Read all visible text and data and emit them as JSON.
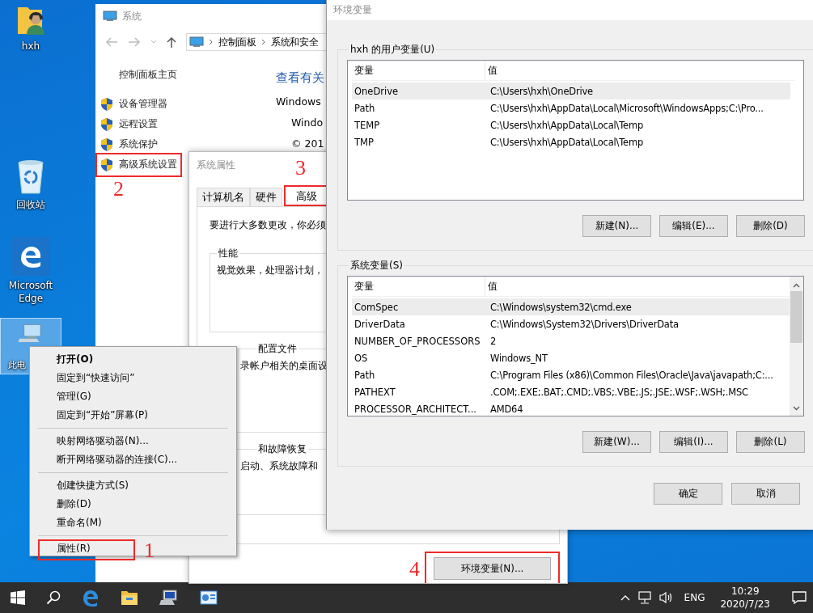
{
  "desktop": {
    "icons": [
      {
        "kind": "user",
        "label": "hxh",
        "selected": false
      },
      {
        "kind": "recycle",
        "label": "回收站",
        "selected": false
      },
      {
        "kind": "edge",
        "label": "Microsoft Edge",
        "selected": false
      },
      {
        "kind": "computer",
        "label": "此电",
        "selected": true
      }
    ]
  },
  "system_window": {
    "title": "系统",
    "breadcrumb": [
      "控制面板",
      "系统和安全"
    ],
    "links": [
      {
        "label": "控制面板主页",
        "shield": false
      },
      {
        "label": "设备管理器",
        "shield": true
      },
      {
        "label": "远程设置",
        "shield": true
      },
      {
        "label": "系统保护",
        "shield": true
      },
      {
        "label": "高级系统设置",
        "shield": true,
        "marker": "2"
      }
    ],
    "heading": "查看有关",
    "info": [
      "Windows",
      "Windo",
      "© 201"
    ]
  },
  "system_properties": {
    "title": "系统属性",
    "tabs": [
      {
        "label": "计算机名",
        "selected": false
      },
      {
        "label": "硬件",
        "selected": false
      },
      {
        "label": "高级",
        "selected": true,
        "marker": "3"
      }
    ],
    "note": "要进行大多数更改，你必须",
    "groups": [
      {
        "title": "性能",
        "text": "视觉效果，处理器计划，"
      },
      {
        "title": "配置文件",
        "text": "录帐户相关的桌面设"
      },
      {
        "title": "和故障恢复",
        "text": "启动、系统故障和"
      }
    ],
    "env_button": {
      "label": "环境变量(N)...",
      "marker": "4"
    }
  },
  "context_menu": {
    "sections": [
      {
        "items": [
          {
            "label": "打开(O)",
            "default": true
          },
          {
            "label": "固定到“快速访问”",
            "default": false
          },
          {
            "label": "管理(G)",
            "default": false
          },
          {
            "label": "固定到“开始”屏幕(P)",
            "default": false
          }
        ]
      },
      {
        "items": [
          {
            "label": "映射网络驱动器(N)...",
            "default": false
          },
          {
            "label": "断开网络驱动器的连接(C)...",
            "default": false
          }
        ]
      },
      {
        "items": [
          {
            "label": "创建快捷方式(S)",
            "default": false
          },
          {
            "label": "删除(D)",
            "default": false
          },
          {
            "label": "重命名(M)",
            "default": false
          }
        ]
      },
      {
        "items": [
          {
            "label": "属性(R)",
            "default": false,
            "marker": "1"
          }
        ]
      }
    ]
  },
  "env_window": {
    "title": "环境变量",
    "groups": [
      {
        "title": "hxh 的用户变量(U)",
        "columns": [
          "变量",
          "值"
        ],
        "scrollbar": false,
        "rows": [
          {
            "name": "OneDrive",
            "value": "C:\\Users\\hxh\\OneDrive",
            "selected": true
          },
          {
            "name": "Path",
            "value": "C:\\Users\\hxh\\AppData\\Local\\Microsoft\\WindowsApps;C:\\Pro...",
            "selected": false
          },
          {
            "name": "TEMP",
            "value": "C:\\Users\\hxh\\AppData\\Local\\Temp",
            "selected": false
          },
          {
            "name": "TMP",
            "value": "C:\\Users\\hxh\\AppData\\Local\\Temp",
            "selected": false
          }
        ],
        "buttons": [
          "新建(N)...",
          "编辑(E)...",
          "删除(D)"
        ]
      },
      {
        "title": "系统变量(S)",
        "columns": [
          "变量",
          "值"
        ],
        "scrollbar": true,
        "rows": [
          {
            "name": "ComSpec",
            "value": "C:\\Windows\\system32\\cmd.exe",
            "selected": true
          },
          {
            "name": "DriverData",
            "value": "C:\\Windows\\System32\\Drivers\\DriverData",
            "selected": false
          },
          {
            "name": "NUMBER_OF_PROCESSORS",
            "value": "2",
            "selected": false
          },
          {
            "name": "OS",
            "value": "Windows_NT",
            "selected": false
          },
          {
            "name": "Path",
            "value": "C:\\Program Files (x86)\\Common Files\\Oracle\\Java\\javapath;C:...",
            "selected": false
          },
          {
            "name": "PATHEXT",
            "value": ".COM;.EXE;.BAT;.CMD;.VBS;.VBE;.JS;.JSE;.WSF;.WSH;.MSC",
            "selected": false
          },
          {
            "name": "PROCESSOR_ARCHITECT...",
            "value": "AMD64",
            "selected": false
          }
        ],
        "buttons": [
          "新建(W)...",
          "编辑(I)...",
          "删除(L)"
        ]
      }
    ],
    "buttons": [
      "确定",
      "取消"
    ]
  },
  "taskbar": {
    "apps": [
      {
        "kind": "edge"
      },
      {
        "kind": "folder"
      },
      {
        "kind": "remote"
      },
      {
        "kind": "panel"
      }
    ],
    "language": "ENG",
    "time": "10:29",
    "date": "2020/7/23"
  }
}
